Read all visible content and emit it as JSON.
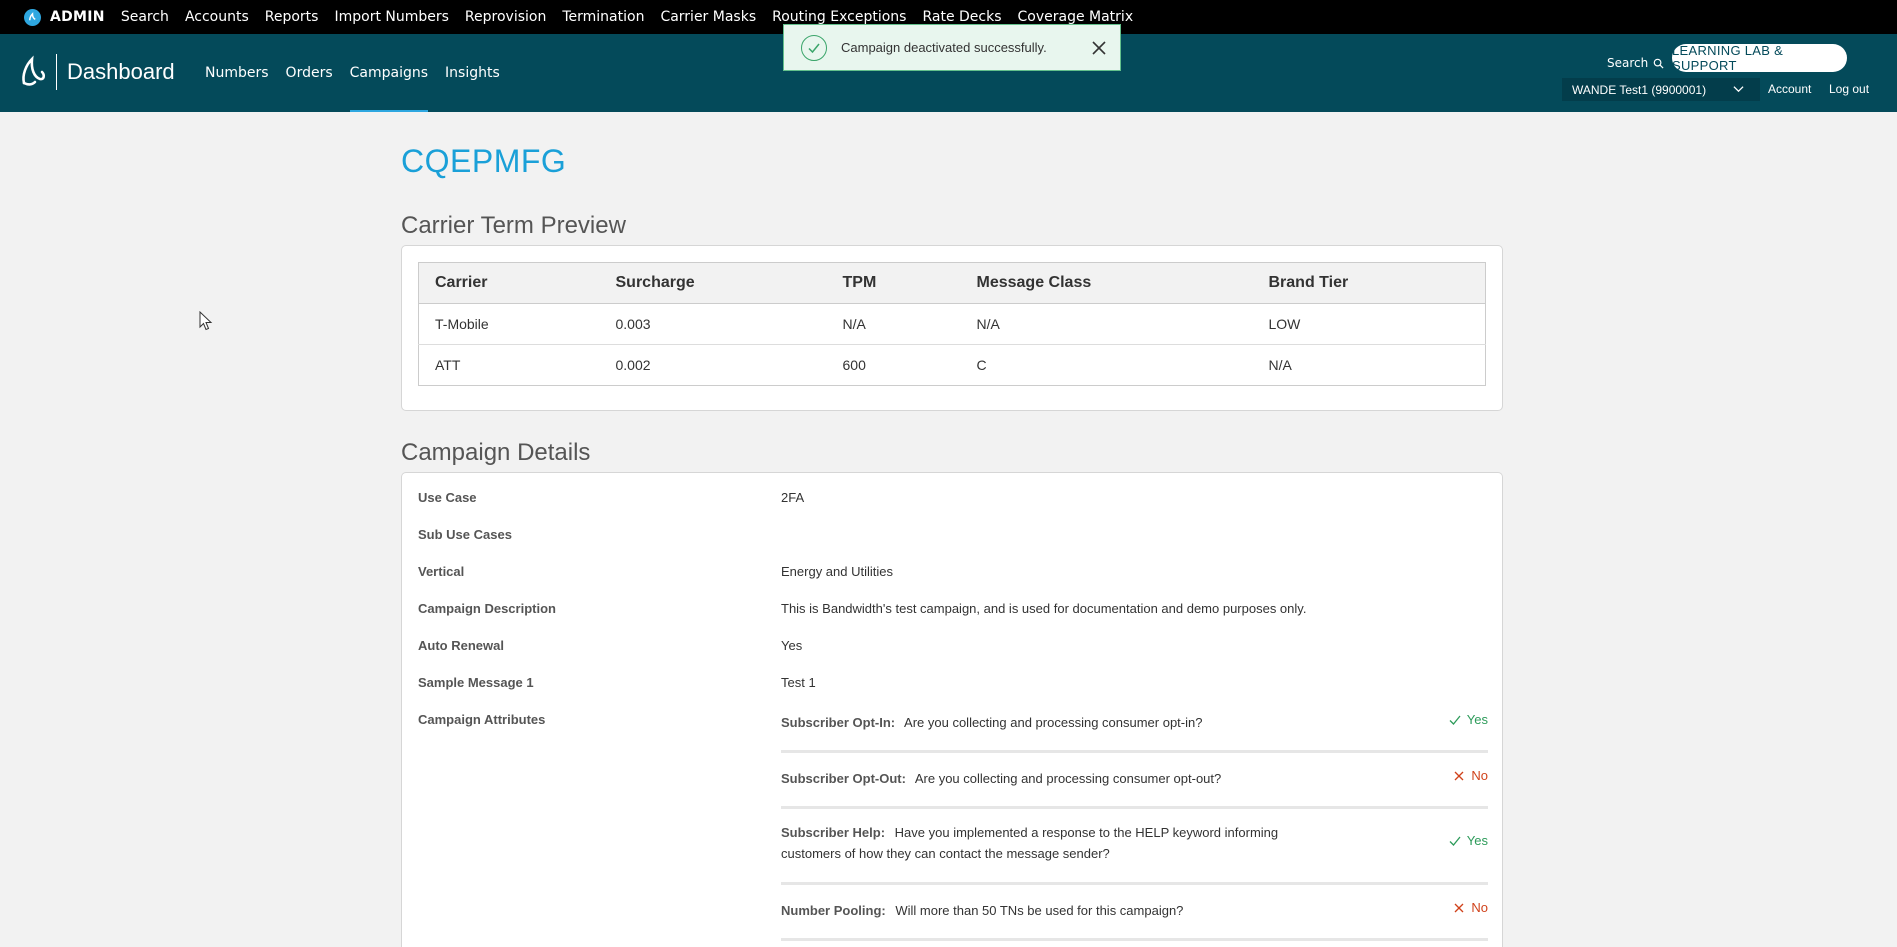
{
  "admin_bar": {
    "label": "ADMIN",
    "links": [
      "Search",
      "Accounts",
      "Reports",
      "Import Numbers",
      "Reprovision",
      "Termination",
      "Carrier Masks",
      "Routing Exceptions",
      "Rate Decks",
      "Coverage Matrix"
    ]
  },
  "header": {
    "title": "Dashboard",
    "nav": [
      "Numbers",
      "Orders",
      "Campaigns",
      "Insights"
    ],
    "active_nav": "Campaigns",
    "search_label": "Search",
    "lab_button": "LEARNING LAB & SUPPORT",
    "account_select": "WANDE Test1 (9900001)",
    "account_link": "Account",
    "logout_link": "Log out"
  },
  "toast": {
    "message": "Campaign deactivated successfully."
  },
  "page": {
    "title": "CQEPMFG"
  },
  "carrier_terms": {
    "section_title": "Carrier Term Preview",
    "columns": [
      "Carrier",
      "Surcharge",
      "TPM",
      "Message Class",
      "Brand Tier"
    ],
    "rows": [
      [
        "T-Mobile",
        "0.003",
        "N/A",
        "N/A",
        "LOW"
      ],
      [
        "ATT",
        "0.002",
        "600",
        "C",
        "N/A"
      ]
    ]
  },
  "campaign_details": {
    "section_title": "Campaign Details",
    "fields": [
      {
        "label": "Use Case",
        "value": "2FA"
      },
      {
        "label": "Sub Use Cases",
        "value": ""
      },
      {
        "label": "Vertical",
        "value": "Energy and Utilities"
      },
      {
        "label": "Campaign Description",
        "value": "This is Bandwidth's test campaign, and is used for documentation and demo purposes only."
      },
      {
        "label": "Auto Renewal",
        "value": "Yes"
      },
      {
        "label": "Sample Message 1",
        "value": "Test 1"
      },
      {
        "label": "Campaign Attributes",
        "value": ""
      }
    ],
    "attributes": [
      {
        "label": "Subscriber Opt-In:",
        "question": "Are you collecting and processing consumer opt-in?",
        "answer": "Yes"
      },
      {
        "label": "Subscriber Opt-Out:",
        "question": "Are you collecting and processing consumer opt-out?",
        "answer": "No"
      },
      {
        "label": "Subscriber Help:",
        "question": "Have you implemented a response to the HELP keyword informing customers of how they can contact the message sender?",
        "answer": "Yes"
      },
      {
        "label": "Number Pooling:",
        "question": "Will more than 50 TNs be used for this campaign?",
        "answer": "No"
      }
    ]
  },
  "colors": {
    "header_bg": "#044a5a",
    "accent": "#1aa0d8",
    "yes": "#2d9b5a",
    "no": "#d0421b"
  }
}
